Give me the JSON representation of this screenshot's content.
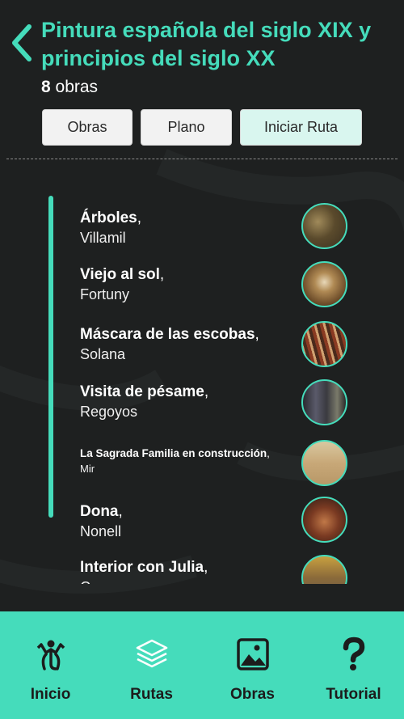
{
  "header": {
    "back_icon": "chevron-left-icon",
    "title": "Pintura española del siglo XIX y principios del siglo XX",
    "count_number": "8",
    "count_label": "obras"
  },
  "tabs": [
    {
      "label": "Obras"
    },
    {
      "label": "Plano"
    },
    {
      "label": "Iniciar Ruta"
    }
  ],
  "artworks": [
    {
      "work": "Árboles",
      "artist": "Villamil",
      "thumb_color": "#6d5a34"
    },
    {
      "work": "Viejo al sol",
      "artist": "Fortuny",
      "thumb_color": "#8a6a3a"
    },
    {
      "work": "Máscara de las escobas",
      "artist": "Solana",
      "thumb_color": "#7c4a2c"
    },
    {
      "work": "Visita de pésame",
      "artist": "Regoyos",
      "thumb_color": "#4c4a3c"
    },
    {
      "work": "La Sagrada Familia en construcción",
      "artist": "Mir",
      "thumb_color": "#c9a874"
    },
    {
      "work": "Dona",
      "artist": "Nonell",
      "thumb_color": "#6a3a22"
    },
    {
      "work": "Interior con Julia",
      "artist": "C",
      "thumb_color": "#9a7a44"
    }
  ],
  "nav": [
    {
      "label": "Inicio",
      "icon": "museum-logo-icon"
    },
    {
      "label": "Rutas",
      "icon": "layers-icon"
    },
    {
      "label": "Obras",
      "icon": "image-icon"
    },
    {
      "label": "Tutorial",
      "icon": "question-icon"
    }
  ],
  "colors": {
    "accent": "#45dcbb",
    "background": "#1e2020"
  }
}
